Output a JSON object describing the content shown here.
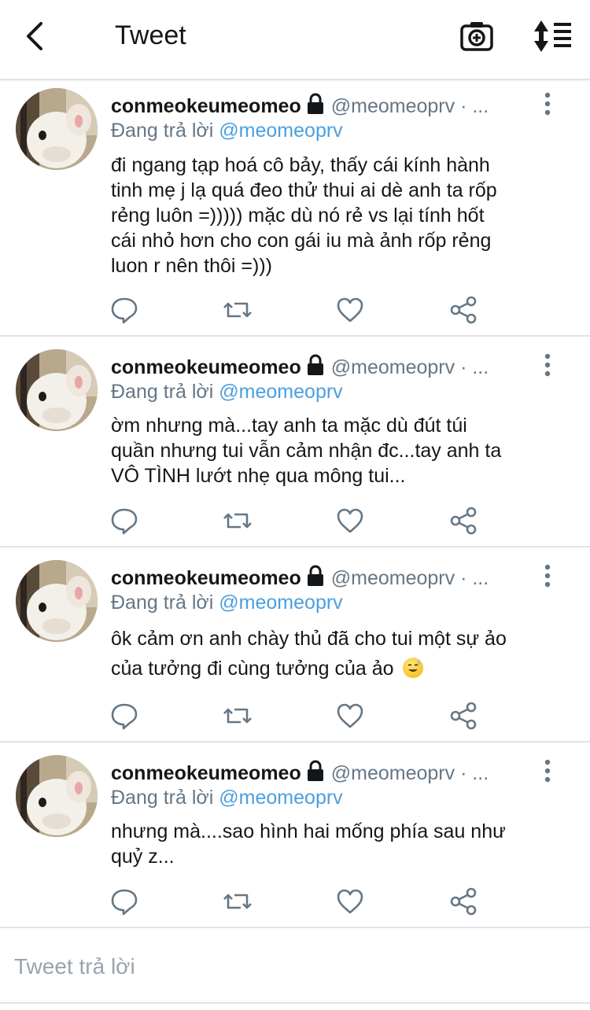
{
  "header": {
    "title": "Tweet",
    "back_icon": "chevron-left-icon",
    "camera_icon": "camera-icon",
    "sort_icon": "sort-list-icon"
  },
  "colors": {
    "accent": "#4a9fe0",
    "muted": "#657786",
    "divider": "#e1e3e6"
  },
  "tweets": [
    {
      "display_name": "conmeokeumeomeo",
      "handle": "@meomeoprv · ...",
      "reply_prefix": "Đang trả lời",
      "reply_to": "@meomeoprv",
      "lines": [
        "đi ngang tạp hoá cô bảy, thấy cái kính hành",
        "tinh mẹ j lạ quá đeo thử thui ai dè anh ta rốp",
        "rẻng luôn =))))) mặc dù nó rẻ vs lại tính hốt",
        "cái nhỏ hơn cho con gái iu mà ảnh rốp rẻng",
        "luon r nên thôi =)))"
      ]
    },
    {
      "display_name": "conmeokeumeomeo",
      "handle": "@meomeoprv · ...",
      "reply_prefix": "Đang trả lời",
      "reply_to": "@meomeoprv",
      "lines": [
        "ờm nhưng mà...tay anh ta mặc dù đút túi",
        "quần nhưng tui vẫn cảm nhận đc...tay anh ta",
        "VÔ TÌNH lướt nhẹ qua mông tui..."
      ]
    },
    {
      "display_name": "conmeokeumeomeo",
      "handle": "@meomeoprv · ...",
      "reply_prefix": "Đang trả lời",
      "reply_to": "@meomeoprv",
      "lines": [
        "ôk cảm ơn anh chày thủ đã cho tui một sự ảo",
        "của tưởng đi cùng tưởng của ảo"
      ]
    },
    {
      "display_name": "conmeokeumeomeo",
      "handle": "@meomeoprv · ...",
      "reply_prefix": "Đang trả lời",
      "reply_to": "@meomeoprv",
      "lines": [
        "nhưng mà....sao hình hai mống phía sau như",
        "quỷ z..."
      ]
    }
  ],
  "reply_box": {
    "placeholder": "Tweet trả lời"
  }
}
